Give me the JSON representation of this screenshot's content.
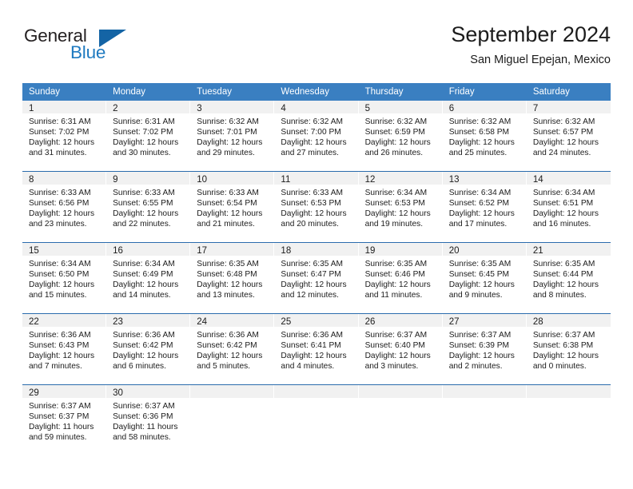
{
  "brand": {
    "name_top": "General",
    "name_bottom": "Blue",
    "triangle_color": "#1464a5",
    "blue_text_color": "#1f7ac0"
  },
  "header": {
    "title": "September 2024",
    "subtitle": "San Miguel Epejan, Mexico"
  },
  "theme": {
    "header_blue": "#3a7fc1",
    "separator_blue": "#2b6cad",
    "day_bar_gray": "#f1f1f1"
  },
  "weekdays": [
    "Sunday",
    "Monday",
    "Tuesday",
    "Wednesday",
    "Thursday",
    "Friday",
    "Saturday"
  ],
  "weeks": [
    [
      {
        "day": "1",
        "sunrise": "Sunrise: 6:31 AM",
        "sunset": "Sunset: 7:02 PM",
        "daylight1": "Daylight: 12 hours",
        "daylight2": "and 31 minutes."
      },
      {
        "day": "2",
        "sunrise": "Sunrise: 6:31 AM",
        "sunset": "Sunset: 7:02 PM",
        "daylight1": "Daylight: 12 hours",
        "daylight2": "and 30 minutes."
      },
      {
        "day": "3",
        "sunrise": "Sunrise: 6:32 AM",
        "sunset": "Sunset: 7:01 PM",
        "daylight1": "Daylight: 12 hours",
        "daylight2": "and 29 minutes."
      },
      {
        "day": "4",
        "sunrise": "Sunrise: 6:32 AM",
        "sunset": "Sunset: 7:00 PM",
        "daylight1": "Daylight: 12 hours",
        "daylight2": "and 27 minutes."
      },
      {
        "day": "5",
        "sunrise": "Sunrise: 6:32 AM",
        "sunset": "Sunset: 6:59 PM",
        "daylight1": "Daylight: 12 hours",
        "daylight2": "and 26 minutes."
      },
      {
        "day": "6",
        "sunrise": "Sunrise: 6:32 AM",
        "sunset": "Sunset: 6:58 PM",
        "daylight1": "Daylight: 12 hours",
        "daylight2": "and 25 minutes."
      },
      {
        "day": "7",
        "sunrise": "Sunrise: 6:32 AM",
        "sunset": "Sunset: 6:57 PM",
        "daylight1": "Daylight: 12 hours",
        "daylight2": "and 24 minutes."
      }
    ],
    [
      {
        "day": "8",
        "sunrise": "Sunrise: 6:33 AM",
        "sunset": "Sunset: 6:56 PM",
        "daylight1": "Daylight: 12 hours",
        "daylight2": "and 23 minutes."
      },
      {
        "day": "9",
        "sunrise": "Sunrise: 6:33 AM",
        "sunset": "Sunset: 6:55 PM",
        "daylight1": "Daylight: 12 hours",
        "daylight2": "and 22 minutes."
      },
      {
        "day": "10",
        "sunrise": "Sunrise: 6:33 AM",
        "sunset": "Sunset: 6:54 PM",
        "daylight1": "Daylight: 12 hours",
        "daylight2": "and 21 minutes."
      },
      {
        "day": "11",
        "sunrise": "Sunrise: 6:33 AM",
        "sunset": "Sunset: 6:53 PM",
        "daylight1": "Daylight: 12 hours",
        "daylight2": "and 20 minutes."
      },
      {
        "day": "12",
        "sunrise": "Sunrise: 6:34 AM",
        "sunset": "Sunset: 6:53 PM",
        "daylight1": "Daylight: 12 hours",
        "daylight2": "and 19 minutes."
      },
      {
        "day": "13",
        "sunrise": "Sunrise: 6:34 AM",
        "sunset": "Sunset: 6:52 PM",
        "daylight1": "Daylight: 12 hours",
        "daylight2": "and 17 minutes."
      },
      {
        "day": "14",
        "sunrise": "Sunrise: 6:34 AM",
        "sunset": "Sunset: 6:51 PM",
        "daylight1": "Daylight: 12 hours",
        "daylight2": "and 16 minutes."
      }
    ],
    [
      {
        "day": "15",
        "sunrise": "Sunrise: 6:34 AM",
        "sunset": "Sunset: 6:50 PM",
        "daylight1": "Daylight: 12 hours",
        "daylight2": "and 15 minutes."
      },
      {
        "day": "16",
        "sunrise": "Sunrise: 6:34 AM",
        "sunset": "Sunset: 6:49 PM",
        "daylight1": "Daylight: 12 hours",
        "daylight2": "and 14 minutes."
      },
      {
        "day": "17",
        "sunrise": "Sunrise: 6:35 AM",
        "sunset": "Sunset: 6:48 PM",
        "daylight1": "Daylight: 12 hours",
        "daylight2": "and 13 minutes."
      },
      {
        "day": "18",
        "sunrise": "Sunrise: 6:35 AM",
        "sunset": "Sunset: 6:47 PM",
        "daylight1": "Daylight: 12 hours",
        "daylight2": "and 12 minutes."
      },
      {
        "day": "19",
        "sunrise": "Sunrise: 6:35 AM",
        "sunset": "Sunset: 6:46 PM",
        "daylight1": "Daylight: 12 hours",
        "daylight2": "and 11 minutes."
      },
      {
        "day": "20",
        "sunrise": "Sunrise: 6:35 AM",
        "sunset": "Sunset: 6:45 PM",
        "daylight1": "Daylight: 12 hours",
        "daylight2": "and 9 minutes."
      },
      {
        "day": "21",
        "sunrise": "Sunrise: 6:35 AM",
        "sunset": "Sunset: 6:44 PM",
        "daylight1": "Daylight: 12 hours",
        "daylight2": "and 8 minutes."
      }
    ],
    [
      {
        "day": "22",
        "sunrise": "Sunrise: 6:36 AM",
        "sunset": "Sunset: 6:43 PM",
        "daylight1": "Daylight: 12 hours",
        "daylight2": "and 7 minutes."
      },
      {
        "day": "23",
        "sunrise": "Sunrise: 6:36 AM",
        "sunset": "Sunset: 6:42 PM",
        "daylight1": "Daylight: 12 hours",
        "daylight2": "and 6 minutes."
      },
      {
        "day": "24",
        "sunrise": "Sunrise: 6:36 AM",
        "sunset": "Sunset: 6:42 PM",
        "daylight1": "Daylight: 12 hours",
        "daylight2": "and 5 minutes."
      },
      {
        "day": "25",
        "sunrise": "Sunrise: 6:36 AM",
        "sunset": "Sunset: 6:41 PM",
        "daylight1": "Daylight: 12 hours",
        "daylight2": "and 4 minutes."
      },
      {
        "day": "26",
        "sunrise": "Sunrise: 6:37 AM",
        "sunset": "Sunset: 6:40 PM",
        "daylight1": "Daylight: 12 hours",
        "daylight2": "and 3 minutes."
      },
      {
        "day": "27",
        "sunrise": "Sunrise: 6:37 AM",
        "sunset": "Sunset: 6:39 PM",
        "daylight1": "Daylight: 12 hours",
        "daylight2": "and 2 minutes."
      },
      {
        "day": "28",
        "sunrise": "Sunrise: 6:37 AM",
        "sunset": "Sunset: 6:38 PM",
        "daylight1": "Daylight: 12 hours",
        "daylight2": "and 0 minutes."
      }
    ],
    [
      {
        "day": "29",
        "sunrise": "Sunrise: 6:37 AM",
        "sunset": "Sunset: 6:37 PM",
        "daylight1": "Daylight: 11 hours",
        "daylight2": "and 59 minutes."
      },
      {
        "day": "30",
        "sunrise": "Sunrise: 6:37 AM",
        "sunset": "Sunset: 6:36 PM",
        "daylight1": "Daylight: 11 hours",
        "daylight2": "and 58 minutes."
      },
      {
        "day": "",
        "sunrise": "",
        "sunset": "",
        "daylight1": "",
        "daylight2": ""
      },
      {
        "day": "",
        "sunrise": "",
        "sunset": "",
        "daylight1": "",
        "daylight2": ""
      },
      {
        "day": "",
        "sunrise": "",
        "sunset": "",
        "daylight1": "",
        "daylight2": ""
      },
      {
        "day": "",
        "sunrise": "",
        "sunset": "",
        "daylight1": "",
        "daylight2": ""
      },
      {
        "day": "",
        "sunrise": "",
        "sunset": "",
        "daylight1": "",
        "daylight2": ""
      }
    ]
  ]
}
